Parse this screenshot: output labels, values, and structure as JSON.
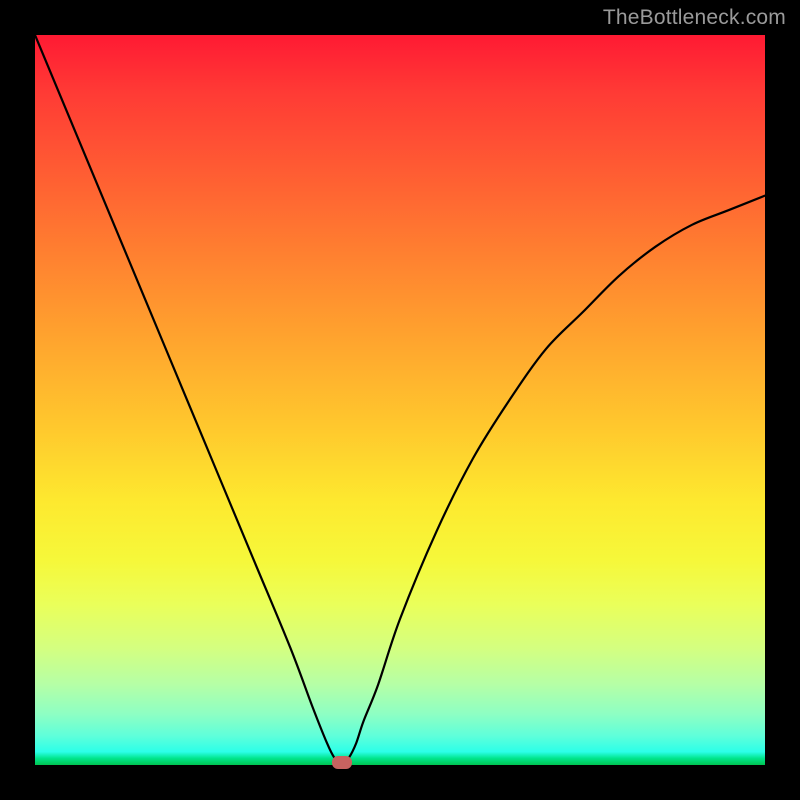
{
  "watermark": "TheBottleneck.com",
  "chart_data": {
    "type": "line",
    "title": "",
    "xlabel": "",
    "ylabel": "",
    "xlim": [
      0,
      100
    ],
    "ylim": [
      0,
      100
    ],
    "grid": false,
    "legend": false,
    "background_gradient": {
      "direction": "vertical",
      "stops": [
        {
          "pos": 0,
          "color": "#ff1a33"
        },
        {
          "pos": 50,
          "color": "#ffc92d"
        },
        {
          "pos": 78,
          "color": "#eaff5a"
        },
        {
          "pos": 100,
          "color": "#00c552"
        }
      ]
    },
    "series": [
      {
        "name": "curve",
        "x": [
          0,
          5,
          10,
          15,
          20,
          25,
          30,
          35,
          38,
          40,
          41,
          42,
          43,
          44,
          45,
          47,
          50,
          55,
          60,
          65,
          70,
          75,
          80,
          85,
          90,
          95,
          100
        ],
        "y": [
          100,
          88,
          76,
          64,
          52,
          40,
          28,
          16,
          8,
          3,
          1,
          0,
          1,
          3,
          6,
          11,
          20,
          32,
          42,
          50,
          57,
          62,
          67,
          71,
          74,
          76,
          78
        ]
      }
    ],
    "marker": {
      "x": 42,
      "y": 0,
      "color": "#c86360"
    }
  }
}
